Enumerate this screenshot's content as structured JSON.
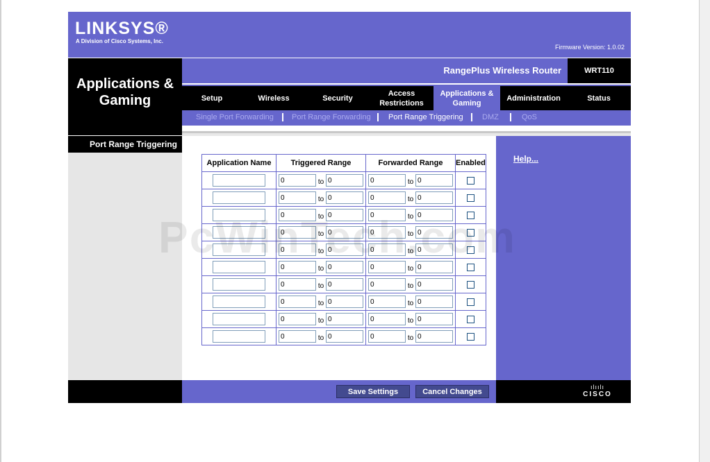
{
  "brand": {
    "logo": "LINKSYS®",
    "tagline": "A Division of Cisco Systems, Inc.",
    "firmware": "Firmware Version: 1.0.02"
  },
  "section_title": "Applications & Gaming",
  "product_name": "RangePlus Wireless Router",
  "model": "WRT110",
  "tabs": [
    {
      "label": "Setup"
    },
    {
      "label": "Wireless"
    },
    {
      "label": "Security"
    },
    {
      "label": "Access Restrictions"
    },
    {
      "label": "Applications & Gaming"
    },
    {
      "label": "Administration"
    },
    {
      "label": "Status"
    }
  ],
  "subtabs": [
    {
      "label": "Single Port Forwarding"
    },
    {
      "label": "Port Range Forwarding"
    },
    {
      "label": "Port Range Triggering"
    },
    {
      "label": "DMZ"
    },
    {
      "label": "QoS"
    }
  ],
  "sidebar_heading": "Port Range Triggering",
  "help_link": "Help...",
  "table": {
    "headers": [
      "Application Name",
      "Triggered Range",
      "Forwarded Range",
      "Enabled"
    ],
    "to_label": "to",
    "rows": [
      {
        "name": "",
        "trig_from": "0",
        "trig_to": "0",
        "fwd_from": "0",
        "fwd_to": "0",
        "enabled": false
      },
      {
        "name": "",
        "trig_from": "0",
        "trig_to": "0",
        "fwd_from": "0",
        "fwd_to": "0",
        "enabled": false
      },
      {
        "name": "",
        "trig_from": "0",
        "trig_to": "0",
        "fwd_from": "0",
        "fwd_to": "0",
        "enabled": false
      },
      {
        "name": "",
        "trig_from": "0",
        "trig_to": "0",
        "fwd_from": "0",
        "fwd_to": "0",
        "enabled": false
      },
      {
        "name": "",
        "trig_from": "0",
        "trig_to": "0",
        "fwd_from": "0",
        "fwd_to": "0",
        "enabled": false
      },
      {
        "name": "",
        "trig_from": "0",
        "trig_to": "0",
        "fwd_from": "0",
        "fwd_to": "0",
        "enabled": false
      },
      {
        "name": "",
        "trig_from": "0",
        "trig_to": "0",
        "fwd_from": "0",
        "fwd_to": "0",
        "enabled": false
      },
      {
        "name": "",
        "trig_from": "0",
        "trig_to": "0",
        "fwd_from": "0",
        "fwd_to": "0",
        "enabled": false
      },
      {
        "name": "",
        "trig_from": "0",
        "trig_to": "0",
        "fwd_from": "0",
        "fwd_to": "0",
        "enabled": false
      },
      {
        "name": "",
        "trig_from": "0",
        "trig_to": "0",
        "fwd_from": "0",
        "fwd_to": "0",
        "enabled": false
      }
    ]
  },
  "buttons": {
    "save": "Save Settings",
    "cancel": "Cancel Changes"
  },
  "watermark": "PcWinTech.com",
  "footer_brand": "CISCO",
  "colors": {
    "accent": "#6666cc",
    "dark": "#000000",
    "button": "#434a8f"
  }
}
